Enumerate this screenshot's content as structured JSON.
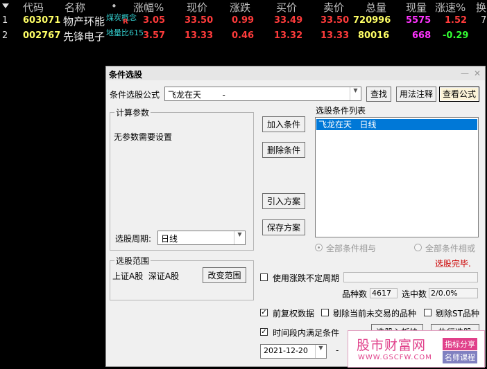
{
  "table": {
    "headers": {
      "code": "代码",
      "name": "名称",
      "dot": "•",
      "change_pct": "涨幅%",
      "price": "现价",
      "change": "涨跌",
      "bid": "买价",
      "ask": "卖价",
      "volume": "总量",
      "cur_vol": "现量",
      "speed": "涨速%",
      "turnover": "换"
    },
    "rows": [
      {
        "idx": "1",
        "code": "603071",
        "name": "物产环能",
        "tag": "煤炭概念",
        "flag": "R",
        "change_pct": "3.05",
        "price": "33.50",
        "change": "0.99",
        "bid": "33.49",
        "ask": "33.50",
        "volume": "720996",
        "cur_vol": "5575",
        "speed": "1.52",
        "turnover": "7"
      },
      {
        "idx": "2",
        "code": "002767",
        "name": "先锋电子",
        "tag": "地量比615",
        "flag": "",
        "change_pct": "3.57",
        "price": "13.33",
        "change": "0.46",
        "bid": "13.32",
        "ask": "13.33",
        "volume": "80016",
        "cur_vol": "668",
        "speed": "-0.29",
        "turnover": ""
      }
    ]
  },
  "dialog": {
    "title": "条件选股",
    "formula_label": "条件选股公式",
    "formula_value": "飞龙在天        -",
    "find_btn": "查找",
    "usage_btn": "用法注释",
    "view_formula_btn": "查看公式",
    "params_group": "计算参数",
    "no_params": "无参数需要设置",
    "period_label": "选股周期:",
    "period_value": "日线",
    "add_btn": "加入条件",
    "delete_btn": "删除条件",
    "import_btn": "引入方案",
    "save_btn": "保存方案",
    "list_label": "选股条件列表",
    "list_items": [
      "飞龙在天   日线"
    ],
    "radio_and": "全部条件相与",
    "radio_or": "全部条件相或",
    "status": "选股完毕.",
    "range_group": "选股范围",
    "range_text": "上证A股  深证A股",
    "change_range_btn": "改变范围",
    "var_period_label": "使用涨跌不定周期",
    "count_label": "品种数",
    "count_value": "4617",
    "selected_label": "选中数",
    "selected_value": "2/0.0%",
    "pre_adjust_label": "前复权数据",
    "exclude_untraded_label": "剔除当前未交易的品种",
    "exclude_st_label": "剔除ST品种",
    "time_period_label": "时间段内满足条件",
    "date_value": "2021-12-20",
    "dash": "-",
    "to_board_btn": "选股入板块",
    "execute_btn": "执行选股",
    "minimize": "—",
    "close": "✕"
  },
  "watermark": {
    "brand": "股市财富网",
    "url": "WWW.GSCFW.COM",
    "badge1": "指标分享",
    "badge2": "名师课程"
  },
  "colors": {
    "red": "#ff3b3b",
    "green": "#33ff33",
    "yellow": "#ffff66",
    "magenta": "#ff33ff",
    "cyan": "#33cccc",
    "selection": "#0078d7",
    "brand_pink": "#e0408a"
  }
}
